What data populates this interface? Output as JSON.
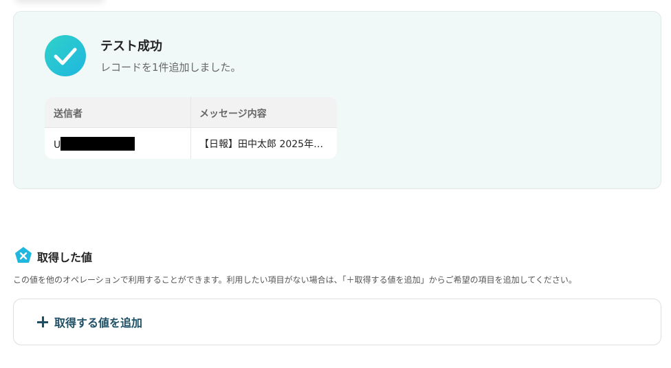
{
  "success": {
    "title": "テスト成功",
    "subtitle": "レコードを1件追加しました。"
  },
  "result_table": {
    "columns": [
      "送信者",
      "メッセージ内容"
    ],
    "rows": [
      {
        "sender": "U",
        "message": "【日報】田中太郎 2025年…"
      }
    ]
  },
  "values_section": {
    "title": "取得した値",
    "description": "この値を他のオペレーションで利用することができます。利用したい項目がない場合は、「＋取得する値を追加」からご希望の項目を追加してください。",
    "add_button_label": "取得する値を追加"
  },
  "colors": {
    "accent": "#1d4e64",
    "success_gradient_start": "#2fd2c7",
    "success_gradient_end": "#1fb6e0",
    "section_icon": "#1fb6e0"
  },
  "icons": {
    "success": "check-icon",
    "section": "yoom-logo-icon",
    "add": "plus-icon"
  }
}
